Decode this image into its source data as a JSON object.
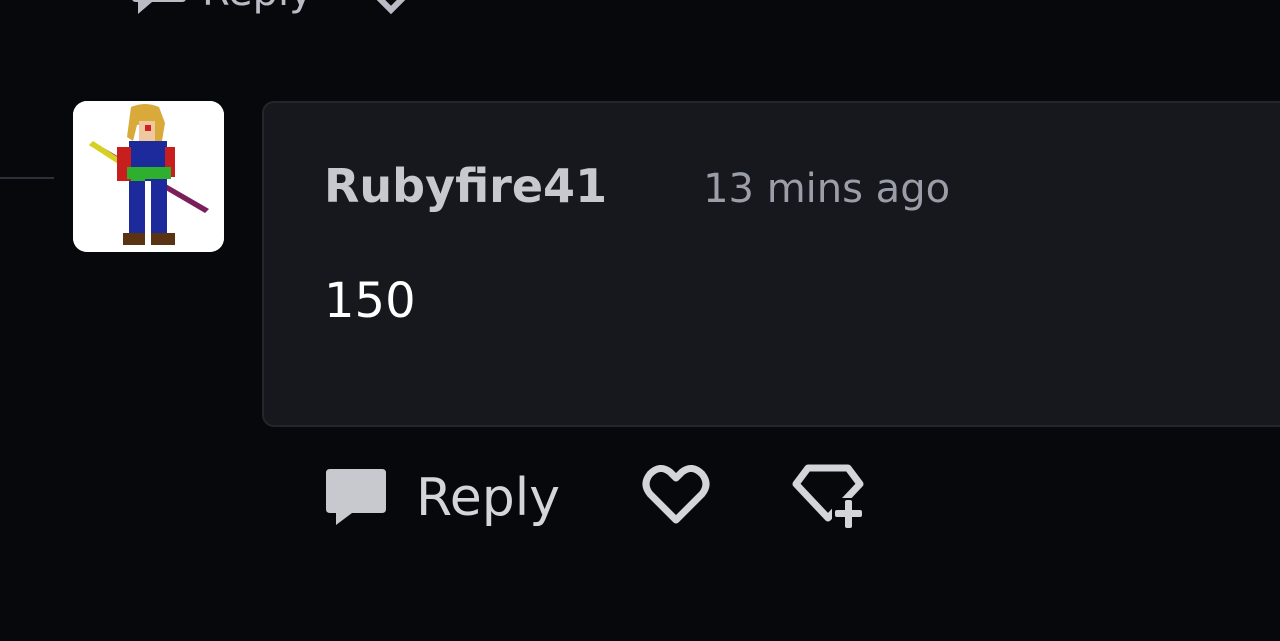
{
  "previous_comment": {
    "reply_label": "Reply"
  },
  "comment": {
    "username": "Rubyfire41",
    "timestamp": "13 mins ago",
    "body": "150",
    "avatar_icon": "pixel-swordsman-avatar"
  },
  "actions": {
    "reply_label": "Reply",
    "reply_icon": "speech-bubble-icon",
    "like_icon": "heart-icon",
    "award_icon": "gem-plus-icon"
  },
  "colors": {
    "background": "#07080c",
    "card": "#16181d",
    "username": "#c7c9cf",
    "timestamp": "#9a9ea8",
    "body": "#ffffff"
  }
}
